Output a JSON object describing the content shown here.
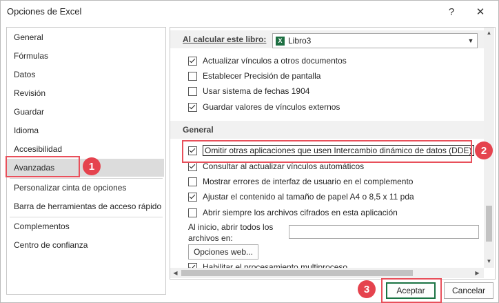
{
  "window": {
    "title": "Opciones de Excel",
    "help_glyph": "?",
    "close_glyph": "✕"
  },
  "nav": {
    "items": [
      {
        "label": "General"
      },
      {
        "label": "Fórmulas"
      },
      {
        "label": "Datos"
      },
      {
        "label": "Revisión"
      },
      {
        "label": "Guardar"
      },
      {
        "label": "Idioma"
      },
      {
        "label": "Accesibilidad"
      },
      {
        "label": "Avanzadas",
        "selected": true
      },
      {
        "label": "Personalizar cinta de opciones"
      },
      {
        "label": "Barra de herramientas de acceso rápido"
      },
      {
        "label": "Complementos"
      },
      {
        "label": "Centro de confianza"
      }
    ]
  },
  "panel": {
    "calc_label": "Al calcular este libro:",
    "workbook_value": "Libro3",
    "workbook_icon": "excel-icon",
    "calc_options": [
      {
        "label": "Actualizar vínculos a otros documentos",
        "checked": true
      },
      {
        "label": "Establecer Precisión de pantalla",
        "checked": false
      },
      {
        "label": "Usar sistema de fechas 1904",
        "checked": false
      },
      {
        "label": "Guardar valores de vínculos externos",
        "checked": true
      }
    ],
    "general_head": "General",
    "general_options": [
      {
        "label": "Omitir otras aplicaciones que usen Intercambio dinámico de datos (DDE)",
        "checked": true
      },
      {
        "label": "Consultar al actualizar vínculos automáticos",
        "checked": true
      },
      {
        "label": "Mostrar errores de interfaz de usuario en el complemento",
        "checked": false
      },
      {
        "label": "Ajustar el contenido al tamaño de papel A4 o 8,5 x 11 pda",
        "checked": true
      },
      {
        "label": "Abrir siempre los archivos cifrados en esta aplicación",
        "checked": false
      }
    ],
    "startup_label_1": "Al inicio, abrir todos los",
    "startup_label_2": "archivos en:",
    "startup_value": "",
    "web_options_label": "Opciones web...",
    "partial_option": {
      "label": "Habilitar el procesamiento multiproceso",
      "checked": true
    }
  },
  "annotations": {
    "badge_1": "1",
    "badge_2": "2",
    "badge_3": "3",
    "color": "#e5434e"
  },
  "footer": {
    "accept_label": "Aceptar",
    "cancel_label": "Cancelar"
  }
}
